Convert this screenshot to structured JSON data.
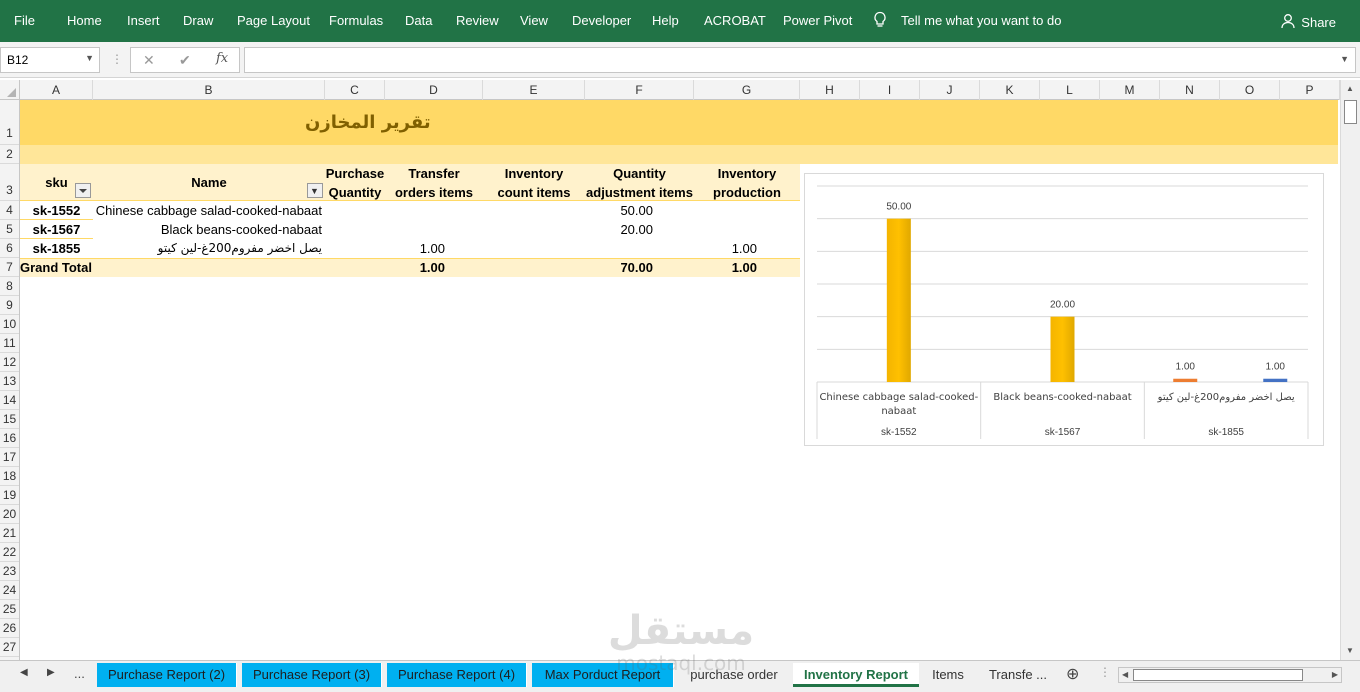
{
  "ribbon": {
    "menu": [
      "File",
      "Home",
      "Insert",
      "Draw",
      "Page Layout",
      "Formulas",
      "Data",
      "Review",
      "View",
      "Developer",
      "Help",
      "ACROBAT",
      "Power Pivot"
    ],
    "tell_me": "Tell me what you want to do",
    "share": "Share",
    "icons": [
      "lightbulb-icon",
      "person-icon"
    ]
  },
  "formula_bar": {
    "name_box": "B12",
    "formula": ""
  },
  "grid": {
    "columns": [
      "A",
      "B",
      "C",
      "D",
      "E",
      "F",
      "G",
      "H",
      "I",
      "J",
      "K",
      "L",
      "M",
      "N",
      "O",
      "P"
    ],
    "rows": [
      "1",
      "2",
      "3",
      "4",
      "5",
      "6",
      "7",
      "8",
      "9",
      "10",
      "11",
      "12",
      "13",
      "14",
      "15",
      "16",
      "17",
      "18",
      "19",
      "20",
      "21",
      "22",
      "23",
      "24",
      "25",
      "26",
      "27"
    ]
  },
  "sheet": {
    "title": "تقرير المخازن",
    "header_fill": "#FFD966",
    "light_fill": "#FFF2CC",
    "pivot": {
      "headers": {
        "sku": "sku",
        "name": "Name",
        "purchase_qty": [
          "Purchase",
          "Quantity"
        ],
        "transfer": [
          "Transfer",
          "orders items"
        ],
        "inventory_count": [
          "Inventory",
          "count items"
        ],
        "qty_adjust": [
          "Quantity",
          "adjustment items"
        ],
        "production": [
          "Inventory",
          "production"
        ]
      },
      "rows": [
        {
          "sku": "sk-1552",
          "name": "Chinese cabbage salad-cooked-nabaat",
          "transfer": "",
          "qty_adjust": "50.00",
          "production": ""
        },
        {
          "sku": "sk-1567",
          "name": "Black beans-cooked-nabaat",
          "transfer": "",
          "qty_adjust": "20.00",
          "production": ""
        },
        {
          "sku": "sk-1855",
          "name": "يصل اخضر مفروم200غ-لين كيتو",
          "transfer": "1.00",
          "qty_adjust": "",
          "production": "1.00"
        }
      ],
      "grand_total": {
        "label": "Grand Total",
        "transfer": "1.00",
        "qty_adjust": "70.00",
        "production": "1.00"
      }
    }
  },
  "chart_data": {
    "type": "bar",
    "categories": [
      {
        "name_lines": [
          "Chinese cabbage salad-cooked-",
          "nabaat"
        ],
        "sku": "sk-1552"
      },
      {
        "name_lines": [
          "Black beans-cooked-nabaat"
        ],
        "sku": "sk-1567"
      },
      {
        "name_lines": [
          "يصل اخضر مفروم200غ-لين كيتو"
        ],
        "sku": "sk-1855"
      }
    ],
    "series": [
      {
        "values": [
          null,
          null,
          1
        ],
        "color": "#ED7D31"
      },
      {
        "values": [
          50,
          20,
          null
        ],
        "color": "#FFC000"
      },
      {
        "values": [
          null,
          null,
          1
        ],
        "color": "#4472C4"
      }
    ],
    "data_labels": [
      "50.00",
      "20.00",
      "1.00",
      "1.00"
    ],
    "ylim": [
      0,
      60
    ],
    "grid": true
  },
  "tabs": {
    "more": "...",
    "items": [
      "Purchase Report (2)",
      "Purchase Report (3)",
      "Purchase Report (4)",
      "Max Porduct Report",
      "purchase order",
      "Inventory Report",
      "Items",
      "Transfe ..."
    ],
    "active": "Inventory Report",
    "tab_color": "#00B0F0"
  },
  "watermark": {
    "main": "مستقل",
    "sub": "mostaql.com"
  }
}
